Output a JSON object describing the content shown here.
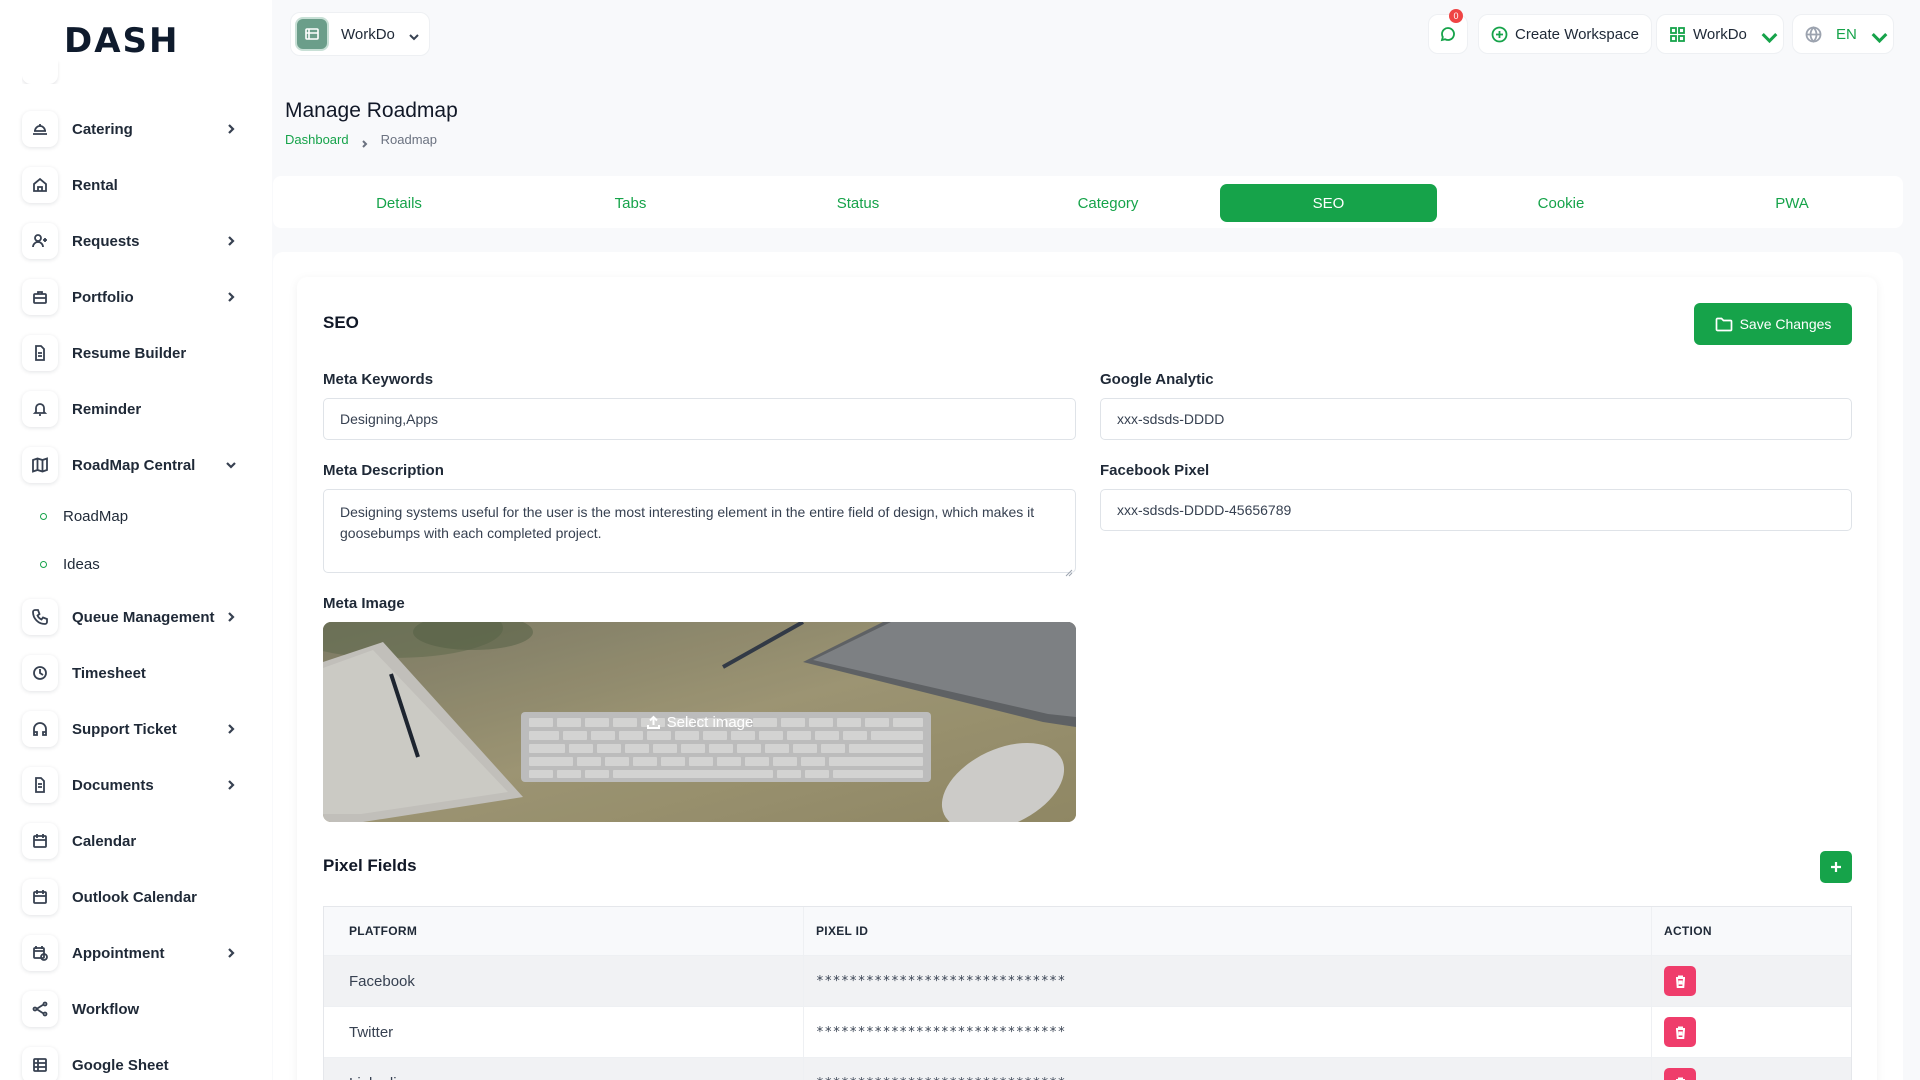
{
  "brand": {
    "logo_text": "DASH"
  },
  "sidebar": {
    "items": [
      {
        "label": "Catering",
        "icon": "catering-icon",
        "has_children": true
      },
      {
        "label": "Rental",
        "icon": "home-icon",
        "has_children": false
      },
      {
        "label": "Requests",
        "icon": "user-plus-icon",
        "has_children": true
      },
      {
        "label": "Portfolio",
        "icon": "briefcase-icon",
        "has_children": true
      },
      {
        "label": "Resume Builder",
        "icon": "file-icon",
        "has_children": false
      },
      {
        "label": "Reminder",
        "icon": "bell-icon",
        "has_children": false
      },
      {
        "label": "RoadMap Central",
        "icon": "map-icon",
        "has_children": true,
        "expanded": true
      },
      {
        "label": "Queue Management",
        "icon": "phone-icon",
        "has_children": true
      },
      {
        "label": "Timesheet",
        "icon": "clock-icon",
        "has_children": false
      },
      {
        "label": "Support Ticket",
        "icon": "headphones-icon",
        "has_children": true
      },
      {
        "label": "Documents",
        "icon": "document-icon",
        "has_children": true
      },
      {
        "label": "Calendar",
        "icon": "calendar-icon",
        "has_children": false
      },
      {
        "label": "Outlook Calendar",
        "icon": "calendar-icon",
        "has_children": false
      },
      {
        "label": "Appointment",
        "icon": "calendar-clock-icon",
        "has_children": true
      },
      {
        "label": "Workflow",
        "icon": "share-icon",
        "has_children": false
      },
      {
        "label": "Google Sheet",
        "icon": "table-icon",
        "has_children": false
      }
    ],
    "subitems": [
      {
        "label": "RoadMap"
      },
      {
        "label": "Ideas"
      }
    ]
  },
  "topbar": {
    "workspace_name": "WorkDo",
    "notification_count": "0",
    "create_workspace_label": "Create Workspace",
    "workspace_switch_label": "WorkDo",
    "language": "EN"
  },
  "page": {
    "title": "Manage Roadmap",
    "breadcrumb": {
      "home": "Dashboard",
      "current": "Roadmap"
    }
  },
  "tabs": [
    {
      "label": "Details",
      "active": false
    },
    {
      "label": "Tabs",
      "active": false
    },
    {
      "label": "Status",
      "active": false
    },
    {
      "label": "Category",
      "active": false
    },
    {
      "label": "SEO",
      "active": true
    },
    {
      "label": "Cookie",
      "active": false
    },
    {
      "label": "PWA",
      "active": false
    }
  ],
  "seo": {
    "section_title": "SEO",
    "save_label": "Save Changes",
    "meta_keywords_label": "Meta Keywords",
    "meta_keywords_value": "Designing,Apps",
    "google_analytic_label": "Google Analytic",
    "google_analytic_value": "xxx-sdsds-DDDD",
    "meta_description_label": "Meta Description",
    "meta_description_value": "Designing systems useful for the user is the most interesting element in the entire field of design, which makes it goosebumps with each completed project.",
    "facebook_pixel_label": "Facebook Pixel",
    "facebook_pixel_value": "xxx-sdsds-DDDD-45656789",
    "meta_image_label": "Meta Image",
    "select_image_label": "Select image"
  },
  "pixel_fields": {
    "title": "Pixel Fields",
    "columns": [
      "PLATFORM",
      "PIXEL ID",
      "ACTION"
    ],
    "rows": [
      {
        "platform": "Facebook",
        "pixel_id": "******************************"
      },
      {
        "platform": "Twitter",
        "pixel_id": "******************************"
      },
      {
        "platform": "Linkedin",
        "pixel_id": "******************************"
      }
    ]
  },
  "colors": {
    "accent": "#16a34a",
    "danger": "#ef3d6b"
  }
}
